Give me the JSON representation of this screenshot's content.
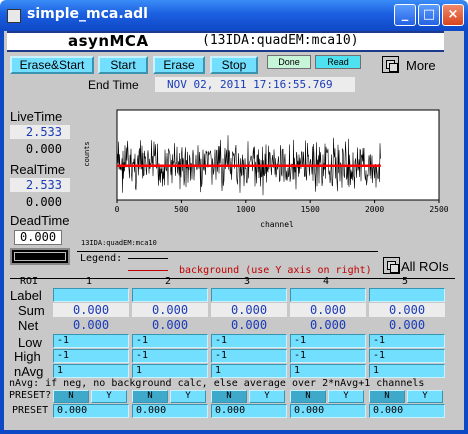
{
  "window": {
    "title": "simple_mca.adl"
  },
  "header": {
    "app_title": "asynMCA",
    "pv_name": "(13IDA:quadEM:mca10)"
  },
  "buttons": {
    "erase_start": "Erase&Start",
    "start": "Start",
    "erase": "Erase",
    "stop": "Stop",
    "more": "More"
  },
  "status": {
    "done": "Done",
    "read": "Read"
  },
  "end_time": {
    "label": "End Time",
    "value": "NOV 02, 2011 17:16:55.769"
  },
  "stats": {
    "live_label": "LiveTime",
    "live_value": "2.533",
    "live_preset": "0.000",
    "real_label": "RealTime",
    "real_value": "2.533",
    "real_preset": "0.000",
    "dead_label": "DeadTime",
    "dead_value": "0.000"
  },
  "chart_data": {
    "type": "line",
    "xlabel": "channel",
    "ylabel": "counts",
    "xlim": [
      0,
      2500
    ],
    "x_ticks": [
      "0",
      "500",
      "1000",
      "1500",
      "2000",
      "2500"
    ],
    "series": [
      {
        "name": "",
        "color": "#000000",
        "x_range": [
          0,
          2048
        ],
        "description_level": "noisy",
        "mean": 0.5,
        "spread": 1
      },
      {
        "name": "background (use Y axis on right)",
        "color": "#ff0000",
        "x": [
          0,
          2048
        ],
        "values": [
          0.5,
          0.5
        ]
      }
    ],
    "footer": "13IDA:quadEM:mca10"
  },
  "legend": {
    "label": "Legend:",
    "background": "background (use Y axis on right)"
  },
  "all_rois": "All ROIs",
  "roi": {
    "header": "ROI",
    "columns": [
      "1",
      "2",
      "3",
      "4",
      "5"
    ],
    "row_labels": {
      "label": "Label",
      "sum": "Sum",
      "net": "Net",
      "low": "Low",
      "high": "High",
      "navg": "nAvg"
    },
    "sum": [
      "0.000",
      "0.000",
      "0.000",
      "0.000",
      "0.000"
    ],
    "net": [
      "0.000",
      "0.000",
      "0.000",
      "0.000",
      "0.000"
    ],
    "low": [
      "-1",
      "-1",
      "-1",
      "-1",
      "-1"
    ],
    "high": [
      "-1",
      "-1",
      "-1",
      "-1",
      "-1"
    ],
    "navg": [
      "1",
      "1",
      "1",
      "1",
      "1"
    ],
    "note": "nAvg: if neg, no background calc, else average over 2*nAvg+1 channels",
    "preset_q_label": "PRESET?",
    "preset_label": "PRESET",
    "n_label": "N",
    "y_label": "Y",
    "preset": [
      "0.000",
      "0.000",
      "0.000",
      "0.000",
      "0.000"
    ]
  }
}
